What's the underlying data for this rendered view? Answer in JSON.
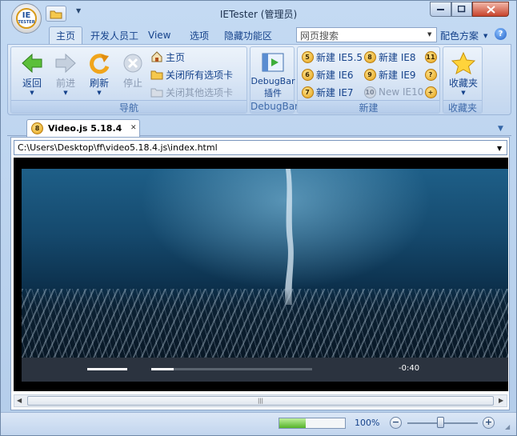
{
  "window": {
    "title": "IETester (管理员)"
  },
  "app_logo": {
    "top": "IE",
    "bottom": "TESTER"
  },
  "ribbon_tabs": [
    "主页",
    "开发人员工",
    "View",
    "选项",
    "隐藏功能区"
  ],
  "search": {
    "value": "网页搜索"
  },
  "color_scheme": "配色方案",
  "help_glyph": "?",
  "groups": {
    "nav": {
      "label": "导航",
      "back": "返回",
      "forward": "前进",
      "refresh": "刷新",
      "stop": "停止",
      "home": "主页",
      "close_all": "关闭所有选项卡",
      "close_others": "关闭其他选项卡"
    },
    "debugbar": {
      "label": "DebugBar",
      "button_line1": "DebugBar",
      "button_line2": "插件"
    },
    "new": {
      "label": "新建",
      "items": [
        {
          "badge": "5",
          "text": "新建 IE5.5"
        },
        {
          "badge": "6",
          "text": "新建 IE6"
        },
        {
          "badge": "7",
          "text": "新建 IE7"
        },
        {
          "badge": "8",
          "text": "新建 IE8"
        },
        {
          "badge": "9",
          "text": "新建 IE9"
        },
        {
          "badge": "10",
          "text": "New IE10"
        }
      ],
      "extra_badges": [
        "11",
        "?",
        "+"
      ]
    },
    "favorites": {
      "label": "收藏夹",
      "button": "收藏夹"
    }
  },
  "doc_tab": {
    "badge": "8",
    "title": "Video.js 5.18.4",
    "close": "✕"
  },
  "address": "C:\\Users\\Desktop\\ff\\video5.18.4.js\\index.html",
  "player": {
    "time": "-0:40",
    "progress": 0.14,
    "volume": 1.0
  },
  "status": {
    "zoom": "100%",
    "load_progress": 0.4,
    "zoom_level": 0.47
  },
  "colors": {
    "accent": "#15428b",
    "player_bar": "#2b333f",
    "ribbon": "#dbe8f6"
  }
}
